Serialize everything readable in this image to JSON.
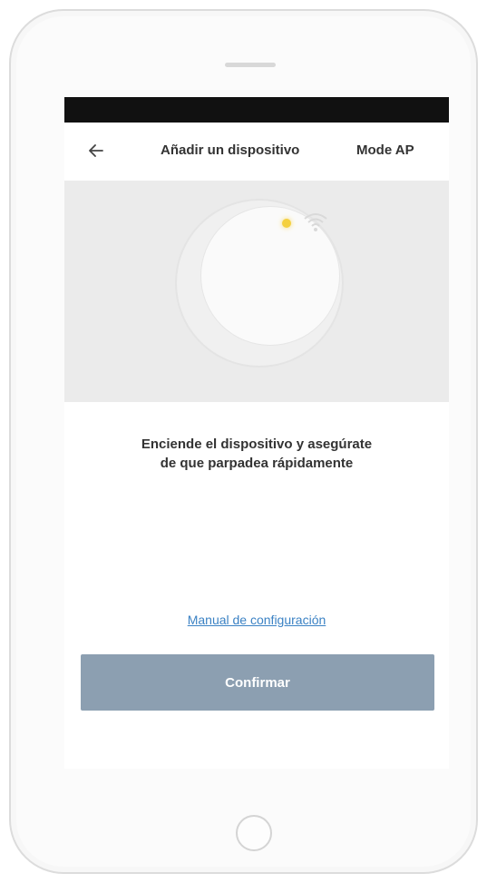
{
  "header": {
    "title": "Añadir un dispositivo",
    "mode_label": "Mode AP",
    "back_icon": "arrow-left-icon"
  },
  "illustration": {
    "led_color": "#f4d03f",
    "icons": [
      "led-indicator-icon",
      "wifi-icon"
    ]
  },
  "instruction": {
    "line1": "Enciende el dispositivo y asegúrate",
    "line2": "de que parpadea rápidamente"
  },
  "manual_link": "Manual de configuración",
  "confirm_label": "Confirmar",
  "colors": {
    "accent_link": "#3b82c4",
    "button_bg": "#8c9fb1",
    "illustration_bg": "#ebebeb"
  }
}
